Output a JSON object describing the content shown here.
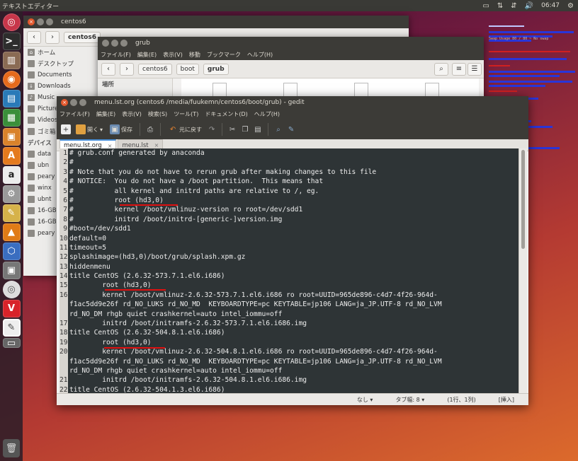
{
  "topbar": {
    "title": "テキストエディター",
    "clock": "06:47"
  },
  "conky": {
    "rows": [
      "Swap Usage",
      "80",
      "/ 80",
      "~ No swap"
    ]
  },
  "nautilus_back": {
    "title": "centos6",
    "crumb": "centos6",
    "sidebar": [
      "ホーム",
      "デスクトップ",
      "Documents",
      "Downloads",
      "Music",
      "Pictures",
      "Videos",
      "ゴミ箱"
    ],
    "devices_header": "デバイス",
    "devices": [
      "data",
      "ubn",
      "peary",
      "winx",
      "ubnt",
      "16-GB",
      "16-GB",
      "peary"
    ]
  },
  "nautilus_front": {
    "title": "grub",
    "menu": [
      "ファイル(F)",
      "編集(E)",
      "表示(V)",
      "移動",
      "ブックマーク",
      "ヘルプ(H)"
    ],
    "crumbs": [
      "centos6",
      "boot",
      "grub"
    ],
    "sidebar_header": "場所"
  },
  "gedit": {
    "title": "menu.lst.org (centos6 /media/fuukemn/centos6/boot/grub) - gedit",
    "menu": [
      "ファイル(F)",
      "編集(E)",
      "表示(V)",
      "検索(S)",
      "ツール(T)",
      "ドキュメント(D)",
      "ヘルプ(H)"
    ],
    "toolbar": {
      "open": "開く",
      "save": "保存",
      "undo": "元に戻す"
    },
    "tabs": [
      "menu.lst.org",
      "menu.lst"
    ],
    "lines": [
      {
        "n": "1",
        "t": "# grub.conf generated by anaconda"
      },
      {
        "n": "2",
        "t": "#"
      },
      {
        "n": "3",
        "t": "# Note that you do not have to rerun grub after making changes to this file"
      },
      {
        "n": "4",
        "t": "# NOTICE:  You do not have a /boot partition.  This means that"
      },
      {
        "n": "5",
        "t": "#          all kernel and initrd paths are relative to /, eg."
      },
      {
        "n": "6",
        "t": "#          root (hd3,0)"
      },
      {
        "n": "7",
        "t": "#          kernel /boot/vmlinuz-version ro root=/dev/sdd1"
      },
      {
        "n": "8",
        "t": "#          initrd /boot/initrd-[generic-]version.img"
      },
      {
        "n": "9",
        "t": "#boot=/dev/sdd1"
      },
      {
        "n": "10",
        "t": "default=0"
      },
      {
        "n": "11",
        "t": "timeout=5"
      },
      {
        "n": "12",
        "t": "splashimage=(hd3,0)/boot/grub/splash.xpm.gz"
      },
      {
        "n": "13",
        "t": "hiddenmenu"
      },
      {
        "n": "14",
        "t": "title CentOS (2.6.32-573.7.1.el6.i686)"
      },
      {
        "n": "15",
        "t": "        root (hd3,0)"
      },
      {
        "n": "16",
        "t": "        kernel /boot/vmlinuz-2.6.32-573.7.1.el6.i686 ro root=UUID=965de896-c4d7-4f26-964d-"
      },
      {
        "n": "",
        "t": "f1ac5dd9e26f rd_NO_LUKS rd_NO_MD  KEYBOARDTYPE=pc KEYTABLE=jp106 LANG=ja_JP.UTF-8 rd_NO_LVM"
      },
      {
        "n": "",
        "t": "rd_NO_DM rhgb quiet crashkernel=auto intel_iommu=off"
      },
      {
        "n": "17",
        "t": "        initrd /boot/initramfs-2.6.32-573.7.1.el6.i686.img"
      },
      {
        "n": "18",
        "t": "title CentOS (2.6.32-504.8.1.el6.i686)"
      },
      {
        "n": "19",
        "t": "        root (hd3,0)"
      },
      {
        "n": "20",
        "t": "        kernel /boot/vmlinuz-2.6.32-504.8.1.el6.i686 ro root=UUID=965de896-c4d7-4f26-964d-"
      },
      {
        "n": "",
        "t": "f1ac5dd9e26f rd_NO_LUKS rd_NO_MD  KEYBOARDTYPE=pc KEYTABLE=jp106 LANG=ja_JP.UTF-8 rd_NO_LVM"
      },
      {
        "n": "",
        "t": "rd_NO_DM rhgb quiet crashkernel=auto intel_iommu=off"
      },
      {
        "n": "21",
        "t": "        initrd /boot/initramfs-2.6.32-504.8.1.el6.i686.img"
      },
      {
        "n": "22",
        "t": "title CentOS (2.6.32-504.1.3.el6.i686)"
      }
    ],
    "status": {
      "lang": "なし ▾",
      "tab": "タブ幅: 8 ▾",
      "pos": "(1行、1列)",
      "mode": "[挿入]"
    }
  }
}
